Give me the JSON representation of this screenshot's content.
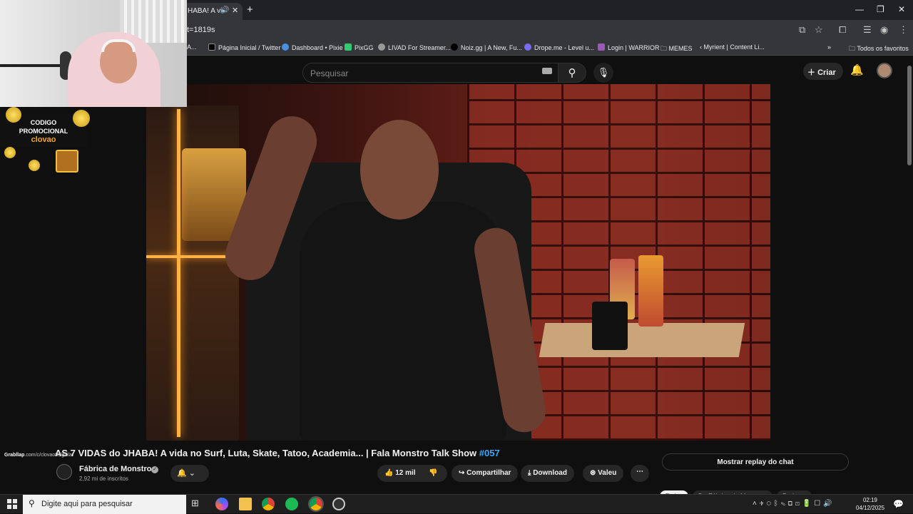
{
  "browser": {
    "tab_title": "HABA! A vi",
    "url": "t=1819s",
    "bookmarks": [
      "A...",
      "Página Inicial / Twitter",
      "Dashboard • Pixie",
      "PixGG",
      "LIVAD For Streamer...",
      "Noiz.gg | A New, Fu...",
      "Drope.me - Level u...",
      "Login | WARRIOR",
      "MEMES",
      "Myrient | Content Li..."
    ],
    "all_bookmarks": "Todos os favoritos"
  },
  "youtube": {
    "search_placeholder": "Pesquisar",
    "create_label": "Criar",
    "video_title_main": "AS 7 VIDAS do JHABA! A vida no Surf, Luta, Skate, Tatoo, Academia... | Fala Monstro Talk Show ",
    "video_title_tag": "#057",
    "channel_name": "Fábrica de Monstros",
    "subscribers": "2,92 mi de inscritos",
    "likes": "12 mil",
    "share_label": "Compartilhar",
    "download_label": "Download",
    "thanks_label": "Valeu",
    "chat_replay_label": "Mostrar replay do chat",
    "chips": [
      "Todos",
      "De Fábrica de Monstros",
      "Podcast"
    ]
  },
  "overlay": {
    "promo_line1": "CODIGO",
    "promo_line2": "PROMOCIONAL",
    "promo_code": "clovao",
    "link_prefix": "Grabllap",
    "link_text": ".com/c/clovao8clgaila"
  },
  "taskbar": {
    "search_placeholder": "Digite aqui para pesquisar",
    "time": "02:19",
    "date": "04/12/2025"
  },
  "colors": {
    "accent_tag": "#3ea6ff",
    "promo_code": "#f5a623"
  }
}
